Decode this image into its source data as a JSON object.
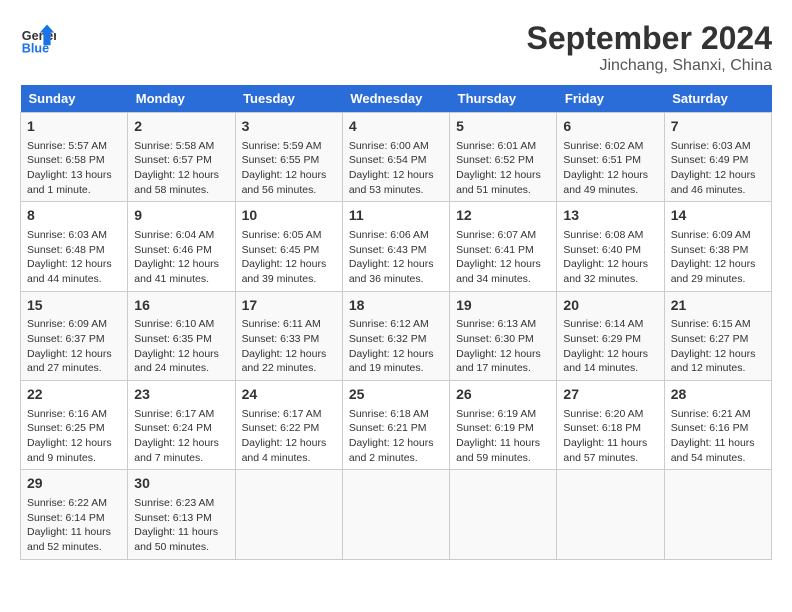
{
  "header": {
    "logo_line1": "General",
    "logo_line2": "Blue",
    "title": "September 2024",
    "subtitle": "Jinchang, Shanxi, China"
  },
  "weekdays": [
    "Sunday",
    "Monday",
    "Tuesday",
    "Wednesday",
    "Thursday",
    "Friday",
    "Saturday"
  ],
  "weeks": [
    [
      {
        "day": "1",
        "info": "Sunrise: 5:57 AM\nSunset: 6:58 PM\nDaylight: 13 hours\nand 1 minute."
      },
      {
        "day": "2",
        "info": "Sunrise: 5:58 AM\nSunset: 6:57 PM\nDaylight: 12 hours\nand 58 minutes."
      },
      {
        "day": "3",
        "info": "Sunrise: 5:59 AM\nSunset: 6:55 PM\nDaylight: 12 hours\nand 56 minutes."
      },
      {
        "day": "4",
        "info": "Sunrise: 6:00 AM\nSunset: 6:54 PM\nDaylight: 12 hours\nand 53 minutes."
      },
      {
        "day": "5",
        "info": "Sunrise: 6:01 AM\nSunset: 6:52 PM\nDaylight: 12 hours\nand 51 minutes."
      },
      {
        "day": "6",
        "info": "Sunrise: 6:02 AM\nSunset: 6:51 PM\nDaylight: 12 hours\nand 49 minutes."
      },
      {
        "day": "7",
        "info": "Sunrise: 6:03 AM\nSunset: 6:49 PM\nDaylight: 12 hours\nand 46 minutes."
      }
    ],
    [
      {
        "day": "8",
        "info": "Sunrise: 6:03 AM\nSunset: 6:48 PM\nDaylight: 12 hours\nand 44 minutes."
      },
      {
        "day": "9",
        "info": "Sunrise: 6:04 AM\nSunset: 6:46 PM\nDaylight: 12 hours\nand 41 minutes."
      },
      {
        "day": "10",
        "info": "Sunrise: 6:05 AM\nSunset: 6:45 PM\nDaylight: 12 hours\nand 39 minutes."
      },
      {
        "day": "11",
        "info": "Sunrise: 6:06 AM\nSunset: 6:43 PM\nDaylight: 12 hours\nand 36 minutes."
      },
      {
        "day": "12",
        "info": "Sunrise: 6:07 AM\nSunset: 6:41 PM\nDaylight: 12 hours\nand 34 minutes."
      },
      {
        "day": "13",
        "info": "Sunrise: 6:08 AM\nSunset: 6:40 PM\nDaylight: 12 hours\nand 32 minutes."
      },
      {
        "day": "14",
        "info": "Sunrise: 6:09 AM\nSunset: 6:38 PM\nDaylight: 12 hours\nand 29 minutes."
      }
    ],
    [
      {
        "day": "15",
        "info": "Sunrise: 6:09 AM\nSunset: 6:37 PM\nDaylight: 12 hours\nand 27 minutes."
      },
      {
        "day": "16",
        "info": "Sunrise: 6:10 AM\nSunset: 6:35 PM\nDaylight: 12 hours\nand 24 minutes."
      },
      {
        "day": "17",
        "info": "Sunrise: 6:11 AM\nSunset: 6:33 PM\nDaylight: 12 hours\nand 22 minutes."
      },
      {
        "day": "18",
        "info": "Sunrise: 6:12 AM\nSunset: 6:32 PM\nDaylight: 12 hours\nand 19 minutes."
      },
      {
        "day": "19",
        "info": "Sunrise: 6:13 AM\nSunset: 6:30 PM\nDaylight: 12 hours\nand 17 minutes."
      },
      {
        "day": "20",
        "info": "Sunrise: 6:14 AM\nSunset: 6:29 PM\nDaylight: 12 hours\nand 14 minutes."
      },
      {
        "day": "21",
        "info": "Sunrise: 6:15 AM\nSunset: 6:27 PM\nDaylight: 12 hours\nand 12 minutes."
      }
    ],
    [
      {
        "day": "22",
        "info": "Sunrise: 6:16 AM\nSunset: 6:25 PM\nDaylight: 12 hours\nand 9 minutes."
      },
      {
        "day": "23",
        "info": "Sunrise: 6:17 AM\nSunset: 6:24 PM\nDaylight: 12 hours\nand 7 minutes."
      },
      {
        "day": "24",
        "info": "Sunrise: 6:17 AM\nSunset: 6:22 PM\nDaylight: 12 hours\nand 4 minutes."
      },
      {
        "day": "25",
        "info": "Sunrise: 6:18 AM\nSunset: 6:21 PM\nDaylight: 12 hours\nand 2 minutes."
      },
      {
        "day": "26",
        "info": "Sunrise: 6:19 AM\nSunset: 6:19 PM\nDaylight: 11 hours\nand 59 minutes."
      },
      {
        "day": "27",
        "info": "Sunrise: 6:20 AM\nSunset: 6:18 PM\nDaylight: 11 hours\nand 57 minutes."
      },
      {
        "day": "28",
        "info": "Sunrise: 6:21 AM\nSunset: 6:16 PM\nDaylight: 11 hours\nand 54 minutes."
      }
    ],
    [
      {
        "day": "29",
        "info": "Sunrise: 6:22 AM\nSunset: 6:14 PM\nDaylight: 11 hours\nand 52 minutes."
      },
      {
        "day": "30",
        "info": "Sunrise: 6:23 AM\nSunset: 6:13 PM\nDaylight: 11 hours\nand 50 minutes."
      },
      {
        "day": "",
        "info": ""
      },
      {
        "day": "",
        "info": ""
      },
      {
        "day": "",
        "info": ""
      },
      {
        "day": "",
        "info": ""
      },
      {
        "day": "",
        "info": ""
      }
    ]
  ]
}
